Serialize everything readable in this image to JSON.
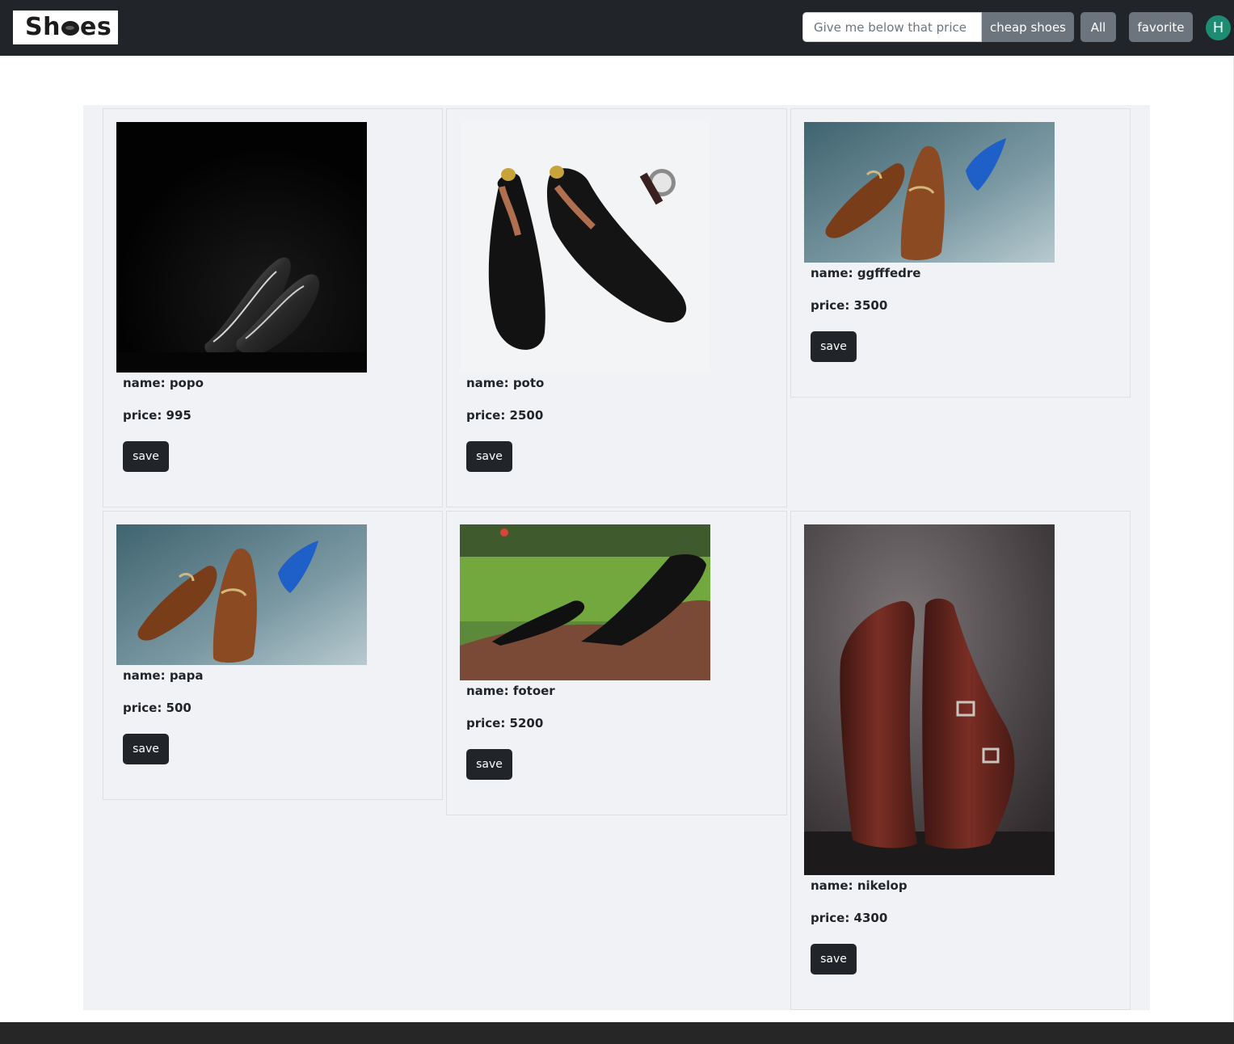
{
  "navbar": {
    "brand": "Shoes",
    "brand_parts": [
      "Sh",
      "es"
    ],
    "search_placeholder": "Give me below that price",
    "search_value": "",
    "cheap_label": "cheap shoes",
    "all_label": "All",
    "favorite_label": "favorite",
    "avatar_initial": "H"
  },
  "colors": {
    "navbar_bg": "#212529",
    "button_gray": "#6c757d",
    "save_button": "#212529",
    "avatar": "#1e8c72",
    "content_bg": "#f0f2f5"
  },
  "products": [
    {
      "name_text": "name: popo",
      "price_text": "price: 995",
      "save_label": "save",
      "image": "black-loafers-on-dark-background"
    },
    {
      "name_text": "name: poto",
      "price_text": "price: 2500",
      "save_label": "save",
      "image": "black-lace-up-shoes-with-watch"
    },
    {
      "name_text": "name: ggfffedre",
      "price_text": "price: 3500",
      "save_label": "save",
      "image": "brown-horsebit-loafers-with-tie"
    },
    {
      "name_text": "name: papa",
      "price_text": "price: 500",
      "save_label": "save",
      "image": "brown-horsebit-loafers-with-tie"
    },
    {
      "name_text": "name: fotoer",
      "price_text": "price: 5200",
      "save_label": "save",
      "image": "black-oxfords-on-wood-in-garden"
    },
    {
      "name_text": "name: nikelop",
      "price_text": "price: 4300",
      "save_label": "save",
      "image": "burgundy-monk-strap-shoes"
    }
  ]
}
